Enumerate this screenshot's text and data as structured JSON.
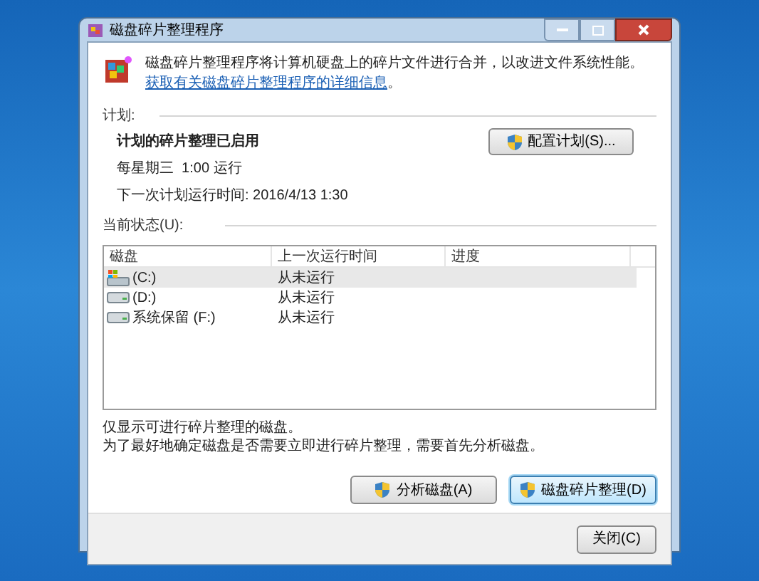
{
  "window": {
    "title": "磁盘碎片整理程序"
  },
  "intro": {
    "text": "磁盘碎片整理程序将计算机硬盘上的碎片文件进行合并，以改进文件系统性能。",
    "link": "获取有关磁盘碎片整理程序的详细信息",
    "end": "。"
  },
  "schedule": {
    "heading": "计划:",
    "status": "计划的碎片整理已启用",
    "frequency": "每星期三  1:00 运行",
    "next_run": "下一次计划运行时间: 2016/4/13 1:30",
    "button": "配置计划(S)..."
  },
  "current_status": {
    "heading": "当前状态(U):",
    "columns": [
      "磁盘",
      "上一次运行时间",
      "进度"
    ],
    "rows": [
      {
        "kind": "system",
        "disk": "(C:)",
        "last_run": "从未运行",
        "selected": true
      },
      {
        "kind": "drive",
        "disk": "(D:)",
        "last_run": "从未运行",
        "selected": false
      },
      {
        "kind": "drive",
        "disk": "系统保留 (F:)",
        "last_run": "从未运行",
        "selected": false
      }
    ]
  },
  "notes": [
    "仅显示可进行碎片整理的磁盘。",
    "为了最好地确定磁盘是否需要立即进行碎片整理，需要首先分析磁盘。"
  ],
  "actions": [
    {
      "label": "分析磁盘(A)",
      "focused": false
    },
    {
      "label": "磁盘碎片整理(D)",
      "focused": true
    }
  ],
  "close_button": "关闭(C)"
}
